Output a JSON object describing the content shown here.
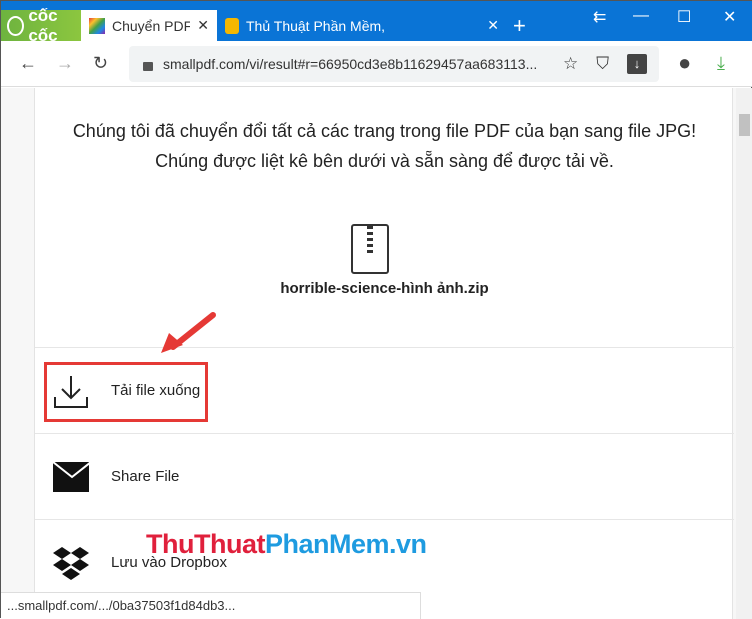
{
  "browser": {
    "brand": "cốc cốc",
    "tabs": [
      {
        "title": "Chuyển PDF sang JPG",
        "active": true
      },
      {
        "title": "Thủ Thuật Phần Mềm,",
        "active": false
      }
    ],
    "url": "smallpdf.com/vi/result#r=66950cd3e8b11629457aa683113...",
    "status_url": "...smallpdf.com/.../0ba37503f1d84db3..."
  },
  "page": {
    "message": "Chúng tôi đã chuyển đổi tất cả các trang trong file PDF của bạn sang file JPG! Chúng được liệt kê bên dưới và sẵn sàng để được tải về.",
    "filename": "horrible-science-hình ảnh.zip",
    "actions": [
      {
        "label": "Tải file xuống",
        "icon": "download-icon"
      },
      {
        "label": "Share File",
        "icon": "envelope-icon"
      },
      {
        "label": "Lưu vào Dropbox",
        "icon": "dropbox-icon"
      }
    ]
  },
  "watermark": {
    "part1": "ThuThuat",
    "part2": "PhanMem",
    "part3": ".vn"
  },
  "colors": {
    "tabbar": "#0a74d6",
    "highlight": "#e53935"
  }
}
